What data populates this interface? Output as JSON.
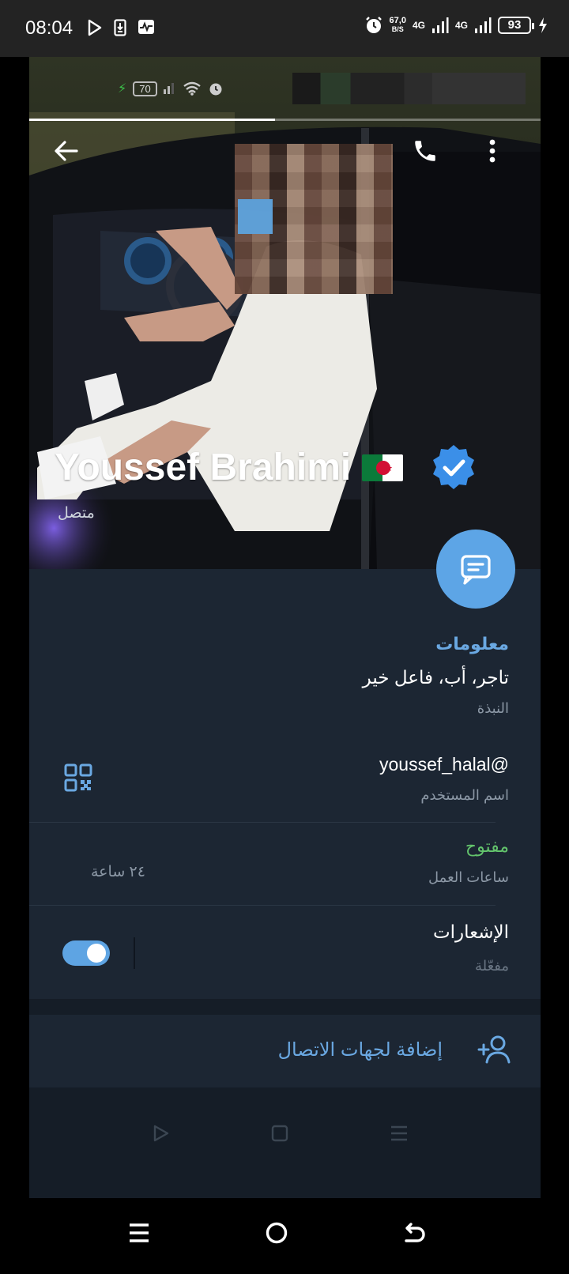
{
  "system_status": {
    "time": "08:04",
    "net_speed_value": "67,0",
    "net_speed_unit": "B/S",
    "network_1": "4G",
    "network_2": "4G",
    "battery": "93"
  },
  "inner_status": {
    "battery": "70"
  },
  "profile": {
    "name": "Youssef Brahimi",
    "status": "متصل",
    "verified": true
  },
  "info": {
    "section_title": "معلومات",
    "bio_value": "تاجر، أب، فاعل خير",
    "bio_label": "النبذة",
    "username_value": "@youssef_halal",
    "username_label": "اسم المستخدم",
    "hours_status": "مفتوح",
    "hours_label": "ساعات العمل",
    "hours_value": "٢٤ ساعة",
    "notifications_title": "الإشعارات",
    "notifications_state": "مفعّلة",
    "notifications_enabled": true
  },
  "actions": {
    "add_contact": "إضافة لجهات الاتصال"
  },
  "colors": {
    "accent": "#6aa8e2",
    "open_status": "#63c46c",
    "panel_bg": "#1c2633"
  }
}
